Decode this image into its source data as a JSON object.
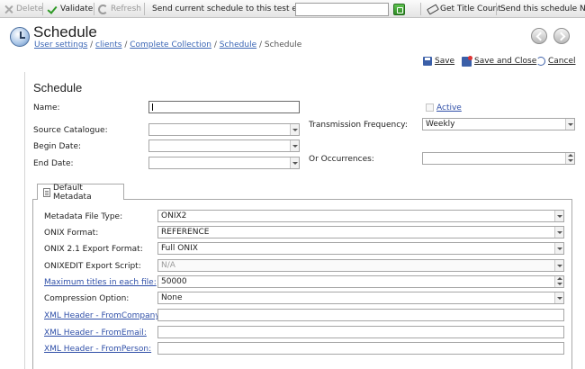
{
  "toolbar": {
    "delete_label": "Delete",
    "validate_label": "Validate",
    "refresh_label": "Refresh",
    "send_test_label": "Send current schedule to this test email",
    "test_email_value": "",
    "get_title_count_label": "Get Title Count",
    "send_now_label": "Send this schedule Now"
  },
  "header": {
    "title": "Schedule",
    "breadcrumb": [
      {
        "label": "User settings",
        "link": true
      },
      {
        "label": "clients",
        "link": true
      },
      {
        "label": "Complete Collection",
        "link": true
      },
      {
        "label": "Schedule",
        "link": true
      },
      {
        "label": "Schedule",
        "link": false
      }
    ],
    "separator": " / ",
    "actions": {
      "save": "Save",
      "save_and_close": "Save and Close",
      "cancel": "Cancel"
    }
  },
  "form": {
    "section_title": "Schedule",
    "name_label": "Name:",
    "name_value": "",
    "active_label": "Active",
    "active_checked": false,
    "source_catalogue_label": "Source Catalogue:",
    "source_catalogue_value": "",
    "transmission_frequency_label": "Transmission Frequency:",
    "transmission_frequency_value": "Weekly",
    "begin_date_label": "Begin Date:",
    "begin_date_value": "",
    "end_date_label": "End Date:",
    "end_date_value": "",
    "or_occurrences_label": "Or Occurrences:",
    "or_occurrences_value": ""
  },
  "tab": {
    "label": "Default Metadata"
  },
  "metadata": {
    "file_type_label": "Metadata File Type:",
    "file_type_value": "ONIX2",
    "onix_format_label": "ONIX Format:",
    "onix_format_value": "REFERENCE",
    "export_format_label": "ONIX 2.1 Export Format:",
    "export_format_value": "Full ONIX",
    "export_script_label": "ONIXEDIT Export Script:",
    "export_script_value": "N/A",
    "max_titles_label": "Maximum titles in each file:",
    "max_titles_value": "50000",
    "compression_label": "Compression Option:",
    "compression_value": "None",
    "from_company_label": "XML Header - FromCompany:",
    "from_company_value": "",
    "from_email_label": "XML Header - FromEmail:",
    "from_email_value": "",
    "from_person_label": "XML Header - FromPerson:",
    "from_person_value": ""
  }
}
